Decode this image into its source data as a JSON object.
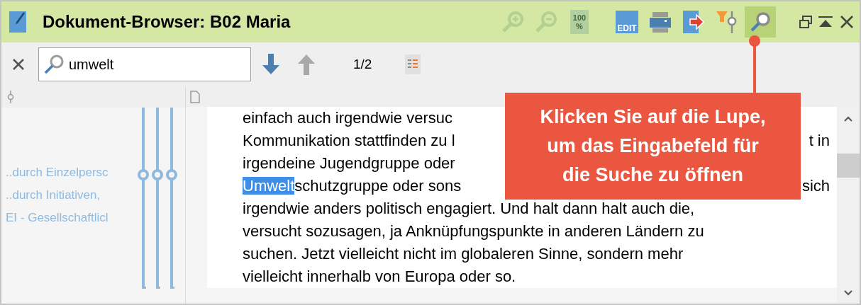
{
  "window": {
    "title": "Dokument-Browser: B02 Maria"
  },
  "toolbar": [
    {
      "kind": "zoom-in",
      "disabled": true,
      "selected": false
    },
    {
      "kind": "zoom-out",
      "disabled": true,
      "selected": false
    },
    {
      "kind": "zoom-100",
      "label_lines": [
        "100",
        "%"
      ],
      "disabled": true,
      "selected": false
    },
    {
      "kind": "edit",
      "label": "EDIT",
      "disabled": false,
      "selected": false
    },
    {
      "kind": "print",
      "disabled": false,
      "selected": false
    },
    {
      "kind": "export",
      "disabled": false,
      "selected": false
    },
    {
      "kind": "filter",
      "disabled": false,
      "selected": false
    },
    {
      "kind": "search",
      "disabled": false,
      "selected": true
    }
  ],
  "search": {
    "value": "umwelt",
    "counter": "1/2"
  },
  "codes": [
    "..durch Einzelpersc",
    "..durch Initiativen,",
    "EI - Gesellschaftlicl"
  ],
  "text_lines": [
    {
      "left": "einfach auch irgendwie versuc"
    },
    {
      "left": "Kommunikation stattfinden zu l",
      "right": "t in"
    },
    {
      "left": "irgendeine Jugendgruppe oder"
    },
    {
      "highlight": "Umwelt",
      "left": "schutzgruppe oder sons",
      "right": "sich"
    },
    {
      "left": "irgendwie anders politisch engagiert. Und halt dann halt auch die,"
    },
    {
      "left": "versucht sozusagen, ja Anknüpfungspunkte in anderen Ländern zu"
    },
    {
      "left": "suchen. Jetzt vielleicht nicht im globaleren Sinne, sondern mehr"
    },
    {
      "left": "vielleicht innerhalb von Europa oder so."
    }
  ],
  "callout": {
    "lines": [
      "Klicken Sie auf die Lupe,",
      "um das Eingabefeld für",
      "die Suche zu öffnen"
    ]
  }
}
